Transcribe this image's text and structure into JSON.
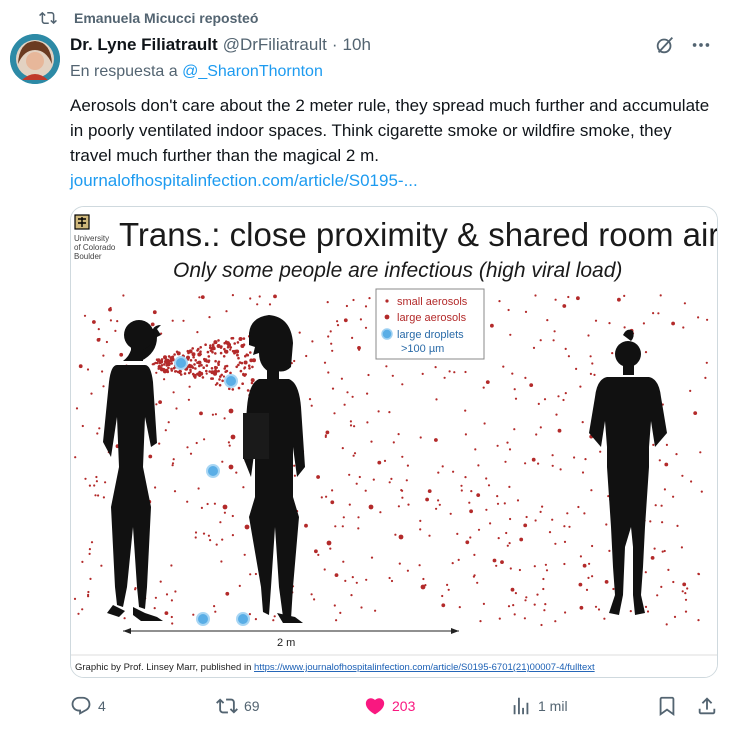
{
  "repost": {
    "label": "Emanuela Micucci reposteó"
  },
  "post": {
    "author": "Dr. Lyne Filiatrault",
    "handle": "@DrFiliatrault",
    "separator": "·",
    "time": "10h",
    "reply_prefix": "En respuesta a",
    "reply_mention": "@_SharonThornton",
    "text": "Aerosols don't care about the 2 meter rule, they spread much further and accumulate in poorly ventilated indoor spaces. Think cigarette smoke or wildfire smoke, they travel much further than the magical 2 m.",
    "link": "journalofhospitalinfection.com/article/S0195-..."
  },
  "media": {
    "logo_lines": [
      "University",
      "of Colorado",
      "Boulder"
    ],
    "title": "Trans.: close proximity & shared room air",
    "subtitle": "Only some people are infectious (high viral load)",
    "legend": [
      "small aerosols",
      "large aerosols",
      "large droplets",
      ">100 µm"
    ],
    "distance_label": "2 m",
    "credit_prefix": "Graphic by Prof. Linsey Marr, published in ",
    "credit_url": "https://www.journalofhospitalinfection.com/article/S0195-6701(21)00007-4/fulltext",
    "colors": {
      "aerosol": "#b32a2a",
      "droplet": "#4a9fd8",
      "silhouette": "#111111"
    }
  },
  "actions": {
    "replies": "4",
    "reposts": "69",
    "likes": "203",
    "views": "1 mil"
  },
  "colors": {
    "link": "#1d9bf0",
    "like": "#f91880",
    "muted": "#536471"
  }
}
